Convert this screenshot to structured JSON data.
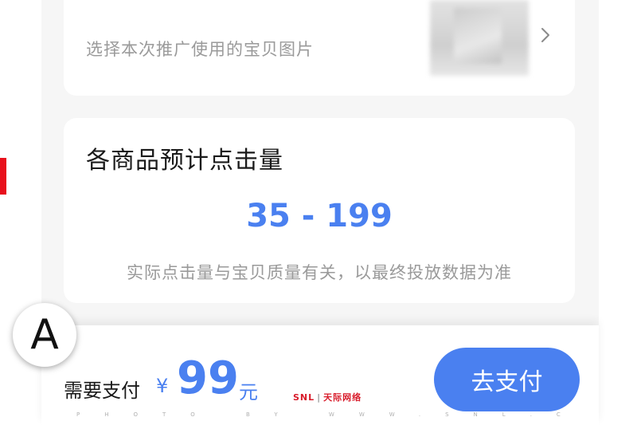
{
  "image_card": {
    "hint": "选择本次推广使用的宝贝图片",
    "chevron_icon": "chevron-right-icon"
  },
  "clicks_card": {
    "title": "各商品预计点击量",
    "range": "35 - 199",
    "note": "实际点击量与宝贝质量有关，以最终投放数据为准"
  },
  "overlay": {
    "badge_letter": "A"
  },
  "footer": {
    "label": "需要支付",
    "currency": "¥",
    "amount": "99",
    "unit": "元",
    "button_label": "去支付"
  },
  "watermark": {
    "logo": "SNL",
    "logo_cn": "天际网络",
    "text": "PHOTO BY WWW.SNL.CN"
  },
  "colors": {
    "accent": "#4a80f0",
    "background": "#f6f6f6",
    "marker": "#e8101c"
  }
}
